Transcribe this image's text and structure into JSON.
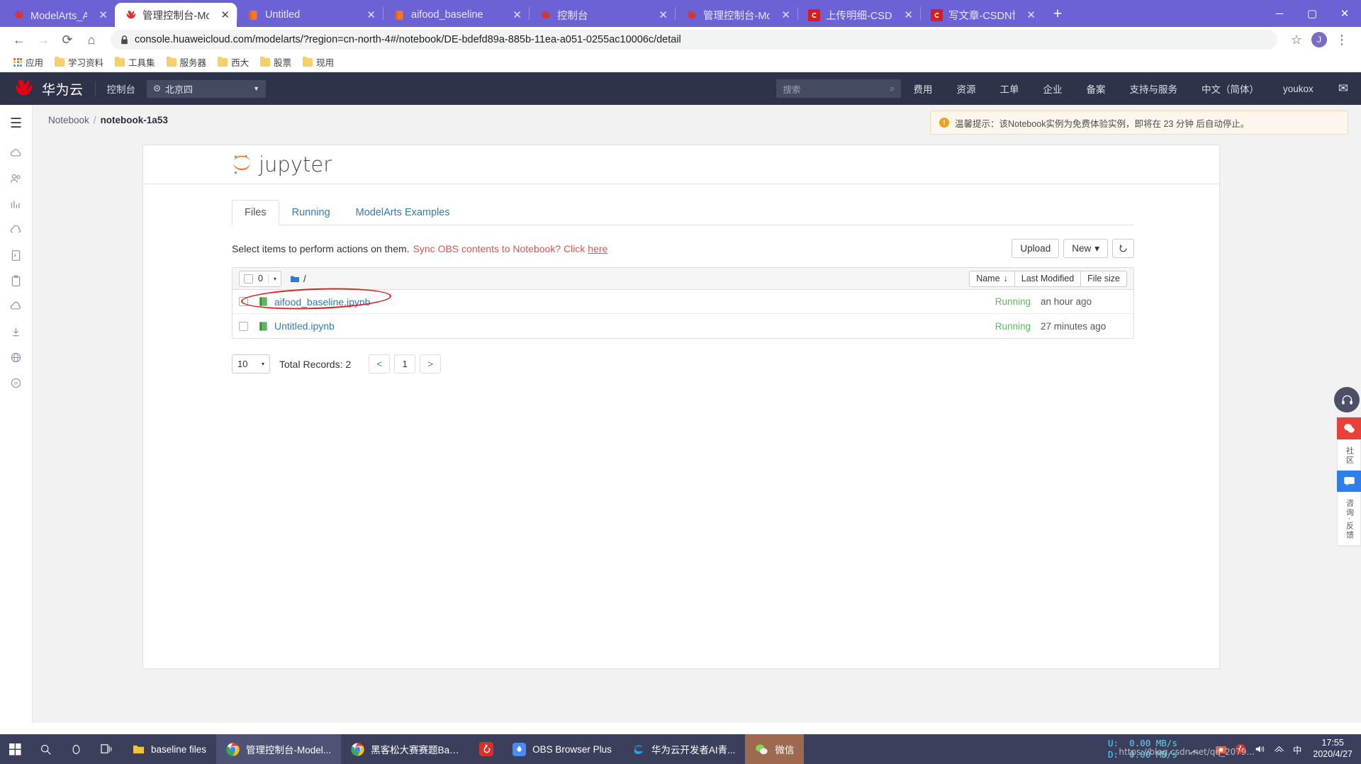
{
  "browser": {
    "tabs": [
      {
        "title": "ModelArts_AI开发平台",
        "favicon": "huawei-icon",
        "active": false
      },
      {
        "title": "管理控制台-ModelArts",
        "favicon": "huawei-icon",
        "active": true
      },
      {
        "title": "Untitled",
        "favicon": "jupyter-icon",
        "active": false
      },
      {
        "title": "aifood_baseline",
        "favicon": "jupyter-icon",
        "active": false
      },
      {
        "title": "控制台",
        "favicon": "huawei-icon",
        "active": false
      },
      {
        "title": "管理控制台-ModelArts",
        "favicon": "huawei-icon",
        "active": false
      },
      {
        "title": "上传明细-CSDN博客",
        "favicon": "csdn-icon",
        "active": false
      },
      {
        "title": "写文章-CSDN博客",
        "favicon": "csdn-icon",
        "active": false
      }
    ],
    "new_tab_label": "+",
    "close_label": "✕",
    "window_controls": {
      "minimize": "─",
      "maximize": "▢",
      "close": "✕"
    },
    "toolbar": {
      "back": "←",
      "forward": "→",
      "reload": "⟳",
      "home": "⌂",
      "lock_icon": "lock-icon",
      "url": "console.huaweicloud.com/modelarts/?region=cn-north-4#/notebook/DE-bdefd89a-885b-11ea-a051-0255ac10006c/detail",
      "star": "☆",
      "profile_initial": "J",
      "menu": "⋮"
    },
    "bookmarks": [
      {
        "label": "应用",
        "icon": "apps-grid-icon"
      },
      {
        "label": "学习资料",
        "icon": "folder-icon"
      },
      {
        "label": "工具集",
        "icon": "folder-icon"
      },
      {
        "label": "服务器",
        "icon": "folder-icon"
      },
      {
        "label": "西大",
        "icon": "folder-icon"
      },
      {
        "label": "股票",
        "icon": "folder-icon"
      },
      {
        "label": "现用",
        "icon": "folder-icon"
      }
    ]
  },
  "hw_header": {
    "brand": "华为云",
    "console": "控制台",
    "region": "北京四",
    "search_placeholder": "搜索",
    "nav": [
      "费用",
      "资源",
      "工单",
      "企业",
      "备案",
      "支持与服务",
      "中文（简体）",
      "youkox"
    ],
    "mail_icon": "envelope-icon"
  },
  "breadcrumb": {
    "root": "Notebook",
    "separator": "/",
    "current": "notebook-1a53"
  },
  "alert": {
    "icon": "warning-icon",
    "text": "温馨提示：该Notebook实例为免费体验实例，即将在 23 分钟 后自动停止。"
  },
  "left_rail": {
    "menu_icon": "hamburger-icon",
    "items": [
      "cloud-icon",
      "users-icon",
      "chart-icon",
      "cloud-upload-icon",
      "terminal-icon",
      "clipboard-icon",
      "cloud-small-icon",
      "download-icon",
      "globe-icon",
      "ip-icon"
    ]
  },
  "jupyter": {
    "logo_text": "jupyter",
    "logo_icon": "jupyter-logo-icon",
    "tabs": [
      {
        "label": "Files",
        "active": true
      },
      {
        "label": "Running",
        "active": false
      },
      {
        "label": "ModelArts Examples",
        "active": false
      }
    ],
    "select_hint": "Select items to perform actions on them.",
    "sync_text": "Sync OBS contents to Notebook? Click",
    "sync_link": "here",
    "upload_label": "Upload",
    "new_label": "New",
    "new_caret": "▾",
    "refresh_icon": "refresh-icon",
    "list_header": {
      "checkbox_count": "0",
      "dropdown_caret": "▾",
      "folder_icon": "folder-icon",
      "path": "/",
      "sort_name": "Name",
      "sort_name_arrow": "↓",
      "sort_modified": "Last Modified",
      "sort_size": "File size"
    },
    "files": [
      {
        "name": "aifood_baseline.ipynb",
        "icon": "notebook-icon",
        "status": "Running",
        "modified": "an hour ago",
        "highlighted": true
      },
      {
        "name": "Untitled.ipynb",
        "icon": "notebook-icon",
        "status": "Running",
        "modified": "27 minutes ago",
        "highlighted": false
      }
    ],
    "pager": {
      "page_size": "10",
      "caret": "▾",
      "total_label": "Total Records: 2",
      "prev": "<",
      "page": "1",
      "next": ">"
    }
  },
  "right_strip": {
    "headset_icon": "headset-icon",
    "cells": [
      {
        "icon": "wechat-icon",
        "label": "",
        "style": "accent"
      },
      {
        "icon": "",
        "label": "社区",
        "style": "plain"
      },
      {
        "icon": "chat-icon",
        "label": "",
        "style": "blue"
      },
      {
        "icon": "",
        "label": "咨询·反馈",
        "style": "plain"
      }
    ]
  },
  "taskbar": {
    "start_icon": "windows-icon",
    "search_icon": "search-icon",
    "cortana_icon": "cortana-icon",
    "taskview_icon": "task-view-icon",
    "items": [
      {
        "label": "baseline files",
        "icon": "folder-icon",
        "state": "plain"
      },
      {
        "label": "管理控制台-Model...",
        "icon": "chrome-icon",
        "state": "active"
      },
      {
        "label": "黑客松大赛赛题Bas...",
        "icon": "chrome-icon",
        "state": "plain"
      },
      {
        "label": "",
        "icon": "netease-music-icon",
        "state": "plain"
      },
      {
        "label": "OBS Browser Plus",
        "icon": "obs-icon",
        "state": "plain"
      },
      {
        "label": "华为云开发者AI青...",
        "icon": "edge-icon",
        "state": "plain"
      },
      {
        "label": "微信",
        "icon": "wechat-icon",
        "state": "wechat"
      }
    ],
    "network": {
      "up_label": "U:",
      "up_value": "0.00 MB/s",
      "down_label": "D:",
      "down_value": "0.00 MB/s",
      "chevron": "︿"
    },
    "tray_icons": [
      "screenshot-icon",
      "netease-icon",
      "volume-icon",
      "network-icon",
      "ime-icon"
    ],
    "clock": {
      "time": "17:55",
      "date": "2020/4/27"
    },
    "watermark": "https://blog.csdn.net/qq_2079..."
  }
}
